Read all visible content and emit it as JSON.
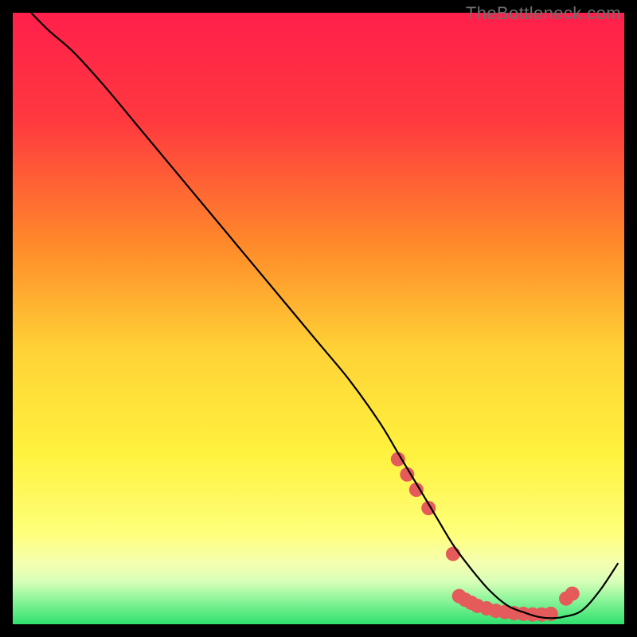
{
  "watermark": "TheBottleneck.com",
  "chart_data": {
    "type": "line",
    "title": "",
    "xlabel": "",
    "ylabel": "",
    "xlim": [
      0,
      100
    ],
    "ylim": [
      0,
      100
    ],
    "grid": false,
    "legend": false,
    "gradient_stops": [
      {
        "offset": 0.0,
        "color": "#ff1f4b"
      },
      {
        "offset": 0.18,
        "color": "#ff3a3f"
      },
      {
        "offset": 0.38,
        "color": "#ff8a2a"
      },
      {
        "offset": 0.55,
        "color": "#ffd236"
      },
      {
        "offset": 0.72,
        "color": "#fff23e"
      },
      {
        "offset": 0.85,
        "color": "#ffff7a"
      },
      {
        "offset": 0.9,
        "color": "#f5ffb0"
      },
      {
        "offset": 0.93,
        "color": "#d8ffb8"
      },
      {
        "offset": 0.96,
        "color": "#8cf59a"
      },
      {
        "offset": 1.0,
        "color": "#2fe06e"
      }
    ],
    "series": [
      {
        "name": "curve",
        "color": "#000000",
        "x": [
          3,
          6,
          10,
          15,
          20,
          25,
          30,
          35,
          40,
          45,
          50,
          55,
          60,
          63,
          66,
          69,
          72,
          75,
          78,
          81,
          84,
          86,
          88,
          90,
          93,
          96,
          99
        ],
        "y": [
          100,
          97,
          93.5,
          88,
          82,
          76,
          70,
          64,
          58,
          52,
          46,
          40,
          33,
          28,
          23,
          18,
          13,
          9,
          5.5,
          3,
          1.8,
          1.2,
          1.0,
          1.2,
          2.2,
          5.5,
          10
        ]
      }
    ],
    "markers": {
      "name": "highlight-dots",
      "color": "#e55a5a",
      "radius": 9,
      "x": [
        63,
        64.5,
        66,
        68,
        72,
        73,
        74,
        75,
        76,
        77.5,
        79,
        80.5,
        82,
        83.5,
        85,
        86.5,
        88,
        90.5,
        91.5
      ],
      "y": [
        27,
        24.5,
        22,
        19,
        11.5,
        4.6,
        4.0,
        3.5,
        3.0,
        2.6,
        2.2,
        2.0,
        1.8,
        1.7,
        1.6,
        1.6,
        1.7,
        4.2,
        5.0
      ]
    }
  }
}
